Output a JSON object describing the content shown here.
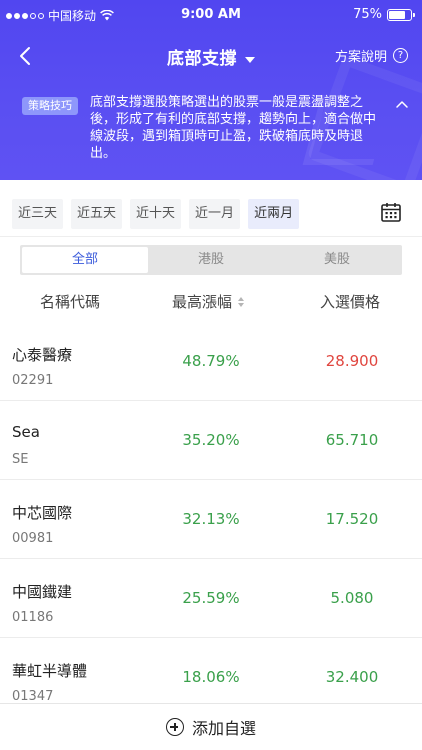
{
  "status_bar": {
    "carrier": "中国移动",
    "time": "9:00 AM",
    "battery_text": "75%",
    "battery_level": 0.75
  },
  "navbar": {
    "title": "底部支撐",
    "plan_label": "方案說明"
  },
  "tip": {
    "badge": "策略技巧",
    "text": "底部支撐選股策略選出的股票一般是震盪調整之後，形成了有利的底部支撐，趨勢向上，適合做中線波段，遇到箱頂時可止盈，跌破箱底時及時退出。"
  },
  "periods": [
    "近三天",
    "近五天",
    "近十天",
    "近一月",
    "近兩月"
  ],
  "selected_period": "近兩月",
  "markets": [
    "全部",
    "港股",
    "美股"
  ],
  "selected_market": "全部",
  "table_headers": {
    "name": "名稱代碼",
    "rise": "最高漲幅",
    "price": "入選價格"
  },
  "stocks": [
    {
      "name": "心泰醫療",
      "code": "02291",
      "rise": "48.79%",
      "price": "28.900",
      "price_color": "#e0463f"
    },
    {
      "name": "Sea",
      "code": "SE",
      "rise": "35.20%",
      "price": "65.710",
      "price_color": "#3aa04b"
    },
    {
      "name": "中芯國際",
      "code": "00981",
      "rise": "32.13%",
      "price": "17.520",
      "price_color": "#3aa04b"
    },
    {
      "name": "中國鐵建",
      "code": "01186",
      "rise": "25.59%",
      "price": "5.080",
      "price_color": "#3aa04b"
    },
    {
      "name": "華虹半導體",
      "code": "01347",
      "rise": "18.06%",
      "price": "32.400",
      "price_color": "#3aa04b"
    }
  ],
  "bottom": {
    "add_label": "添加自選"
  },
  "colors": {
    "header": "#5146f0",
    "up_green": "#3aa04b",
    "down_red": "#e0463f",
    "accent": "#3b5bdb"
  }
}
